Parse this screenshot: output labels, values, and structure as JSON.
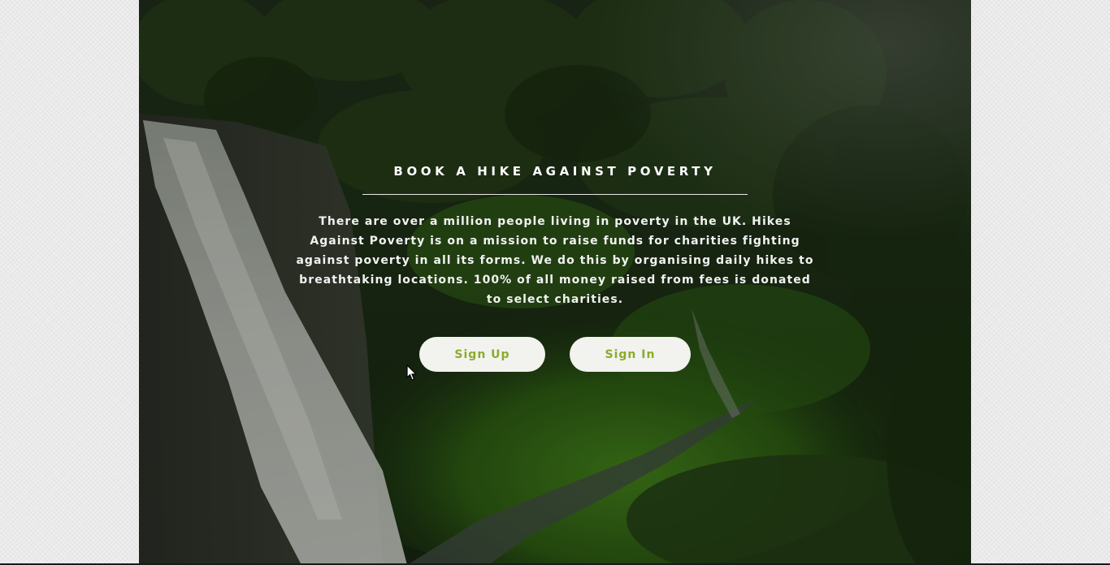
{
  "hero": {
    "title": "BOOK A HIKE AGAINST POVERTY",
    "description": "There are over a million people living in poverty in the UK. Hikes Against Poverty is on a mission to raise funds for charities fighting against poverty in all its forms. We do this by organising daily hikes to breathtaking locations. 100% of all money raised from fees is donated to select charities.",
    "background_image": "waterfall-forest-landscape"
  },
  "actions": {
    "signup_label": "Sign Up",
    "signin_label": "Sign In"
  },
  "colors": {
    "button_text": "#8bab2c",
    "button_bg": "#f2f2ee",
    "page_bg": "#eeeeee"
  },
  "cursor": {
    "icon": "mouse-pointer-icon"
  }
}
